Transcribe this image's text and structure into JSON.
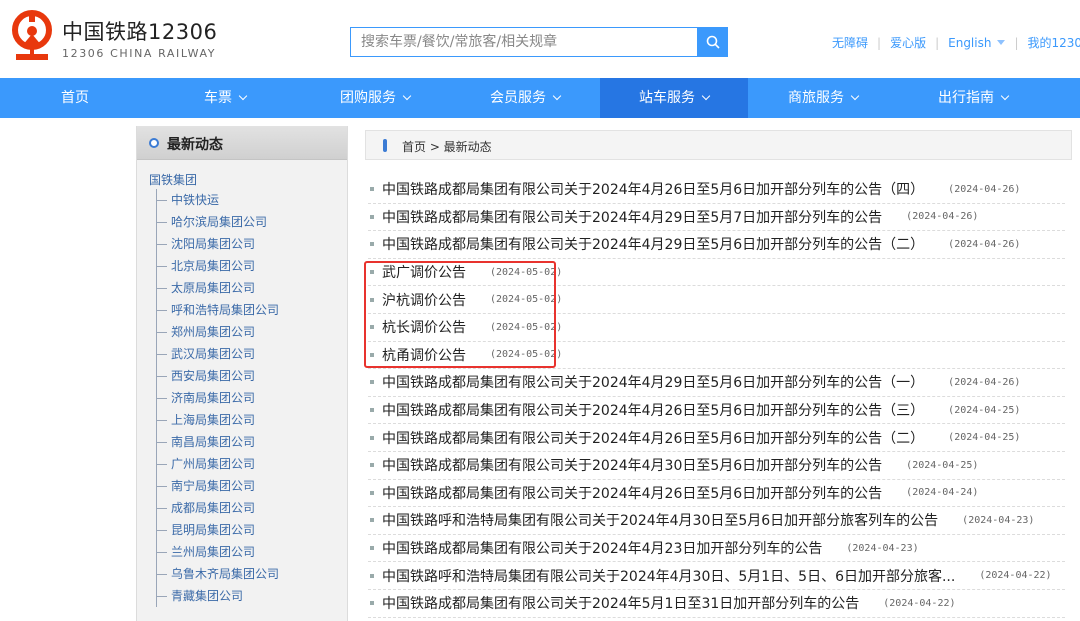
{
  "header": {
    "brand_cn": "中国铁路12306",
    "brand_en": "12306 CHINA RAILWAY",
    "search_placeholder": "搜索车票/餐饮/常旅客/相关规章",
    "links": {
      "accessible": "无障碍",
      "care": "爱心版",
      "english": "English",
      "mine": "我的12306"
    }
  },
  "nav": [
    {
      "label": "首页",
      "has_dropdown": false,
      "active": false
    },
    {
      "label": "车票",
      "has_dropdown": true,
      "active": false
    },
    {
      "label": "团购服务",
      "has_dropdown": true,
      "active": false
    },
    {
      "label": "会员服务",
      "has_dropdown": true,
      "active": false
    },
    {
      "label": "站车服务",
      "has_dropdown": true,
      "active": true
    },
    {
      "label": "商旅服务",
      "has_dropdown": true,
      "active": false
    },
    {
      "label": "出行指南",
      "has_dropdown": true,
      "active": false
    }
  ],
  "sidebar": {
    "title": "最新动态",
    "root": "国铁集团",
    "items": [
      "中铁快运",
      "哈尔滨局集团公司",
      "沈阳局集团公司",
      "北京局集团公司",
      "太原局集团公司",
      "呼和浩特局集团公司",
      "郑州局集团公司",
      "武汉局集团公司",
      "西安局集团公司",
      "济南局集团公司",
      "上海局集团公司",
      "南昌局集团公司",
      "广州局集团公司",
      "南宁局集团公司",
      "成都局集团公司",
      "昆明局集团公司",
      "兰州局集团公司",
      "乌鲁木齐局集团公司",
      "青藏集团公司"
    ]
  },
  "breadcrumb": "首页 > 最新动态",
  "news": [
    {
      "title": "中国铁路成都局集团有限公司关于2024年4月26日至5月6日加开部分列车的公告（四）",
      "date": "(2024-04-26)"
    },
    {
      "title": "中国铁路成都局集团有限公司关于2024年4月29日至5月7日加开部分列车的公告",
      "date": "(2024-04-26)"
    },
    {
      "title": "中国铁路成都局集团有限公司关于2024年4月29日至5月6日加开部分列车的公告（二）",
      "date": "(2024-04-26)"
    },
    {
      "title": "武广调价公告",
      "date": "(2024-05-02)"
    },
    {
      "title": "沪杭调价公告",
      "date": "(2024-05-02)"
    },
    {
      "title": "杭长调价公告",
      "date": "(2024-05-02)"
    },
    {
      "title": "杭甬调价公告",
      "date": "(2024-05-02)"
    },
    {
      "title": "中国铁路成都局集团有限公司关于2024年4月29日至5月6日加开部分列车的公告（一）",
      "date": "(2024-04-26)"
    },
    {
      "title": "中国铁路成都局集团有限公司关于2024年4月26日至5月6日加开部分列车的公告（三）",
      "date": "(2024-04-25)"
    },
    {
      "title": "中国铁路成都局集团有限公司关于2024年4月26日至5月6日加开部分列车的公告（二）",
      "date": "(2024-04-25)"
    },
    {
      "title": "中国铁路成都局集团有限公司关于2024年4月30日至5月6日加开部分列车的公告",
      "date": "(2024-04-25)"
    },
    {
      "title": "中国铁路成都局集团有限公司关于2024年4月26日至5月6日加开部分列车的公告",
      "date": "(2024-04-24)"
    },
    {
      "title": "中国铁路呼和浩特局集团有限公司关于2024年4月30日至5月6日加开部分旅客列车的公告",
      "date": "(2024-04-23)"
    },
    {
      "title": "中国铁路成都局集团有限公司关于2024年4月23日加开部分列车的公告",
      "date": "(2024-04-23)"
    },
    {
      "title": "中国铁路呼和浩特局集团有限公司关于2024年4月30日、5月1日、5日、6日加开部分旅客...",
      "date": "(2024-04-22)"
    },
    {
      "title": "中国铁路成都局集团有限公司关于2024年5月1日至31日加开部分列车的公告",
      "date": "(2024-04-22)"
    }
  ],
  "colors": {
    "brand": "#3b99fc",
    "active_nav": "#2676e3",
    "logo": "#e8380d",
    "highlight": "#e8332e"
  }
}
